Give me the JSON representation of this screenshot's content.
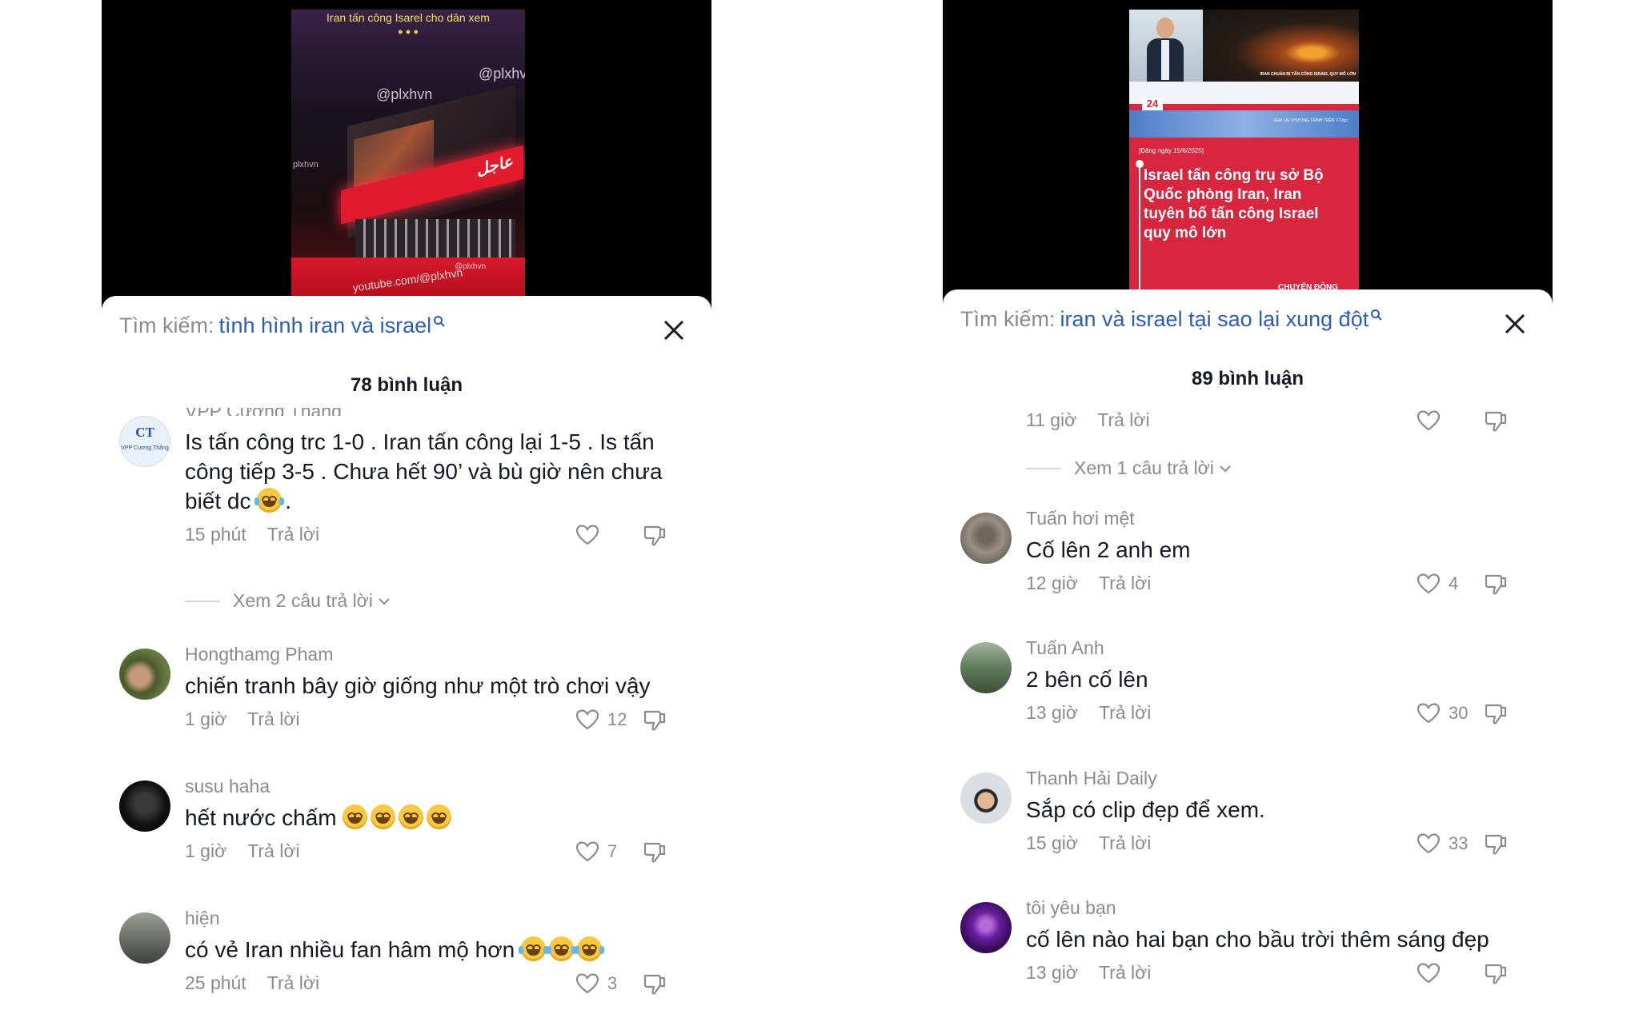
{
  "left": {
    "video": {
      "caption": "Iran tấn công Isarel cho dân xem",
      "watermarks": [
        "@plxhvn",
        "@plxhvn",
        "plxhvn",
        "youtube.com/@plxhvn",
        "@plxhvn"
      ],
      "sign_text": "عاجل"
    },
    "search": {
      "prefix": "Tìm kiếm:",
      "query": "tình hình iran và israel"
    },
    "comment_count": "78 bình luận",
    "comments": [
      {
        "user": "VPP Cương Thắng",
        "avatar_text": "CT",
        "avatar_sub": "VPP Cương Thắng",
        "avatar_color": "#e8f0f8",
        "text": "Is tấn công trc 1-0 . Iran tấn công lại 1-5 . Is tấn công tiếp 3-5 . Chưa hết 90’ và bù giờ nên chưa biết dc",
        "text_tail": ".",
        "time": "15 phút",
        "reply": "Trả lời",
        "likes": "",
        "view_replies": "Xem 2 câu trả lời"
      },
      {
        "user": "Hongthamg Pham",
        "avatar_color": "#5e6b42",
        "text": "chiến tranh bây giờ giống như một trò chơi vậy",
        "time": "1 giờ",
        "reply": "Trả lời",
        "likes": "12"
      },
      {
        "user": "susu haha",
        "avatar_color": "#151515",
        "text": "hết nước chấm",
        "time": "1 giờ",
        "reply": "Trả lời",
        "likes": "7"
      },
      {
        "user": "hiện",
        "avatar_color": "#6c6f69",
        "text": "có vẻ Iran nhiều fan hâm mộ hơn",
        "time": "25 phút",
        "reply": "Trả lời",
        "likes": "3"
      }
    ]
  },
  "right": {
    "video": {
      "channel_badge": "24",
      "headline_small": "IRAN CHUẨN BỊ TẤN CÔNG ISRAEL QUY MÔ LỚN",
      "ticker_small": "XEM LẠI CHƯƠNG TRÌNH TRÊN VTVgo",
      "date_tag": "[Đăng ngày 15/6/2025]",
      "headline": "Israel tấn công trụ sở Bộ Quốc phòng Iran, Iran tuyên bố tấn công Israel quy mô lớn",
      "footer_tag": "CHUYỂN ĐỘNG"
    },
    "search": {
      "prefix": "Tìm kiếm:",
      "query": "iran và israel tại sao lại xung đột"
    },
    "comment_count": "89 bình luận",
    "first_meta": {
      "time": "11 giờ",
      "reply": "Trả lời",
      "view_replies": "Xem 1 câu trả lời"
    },
    "comments": [
      {
        "user": "Tuấn hơi mệt",
        "avatar_color": "#8d8578",
        "text": "Cố lên 2 anh em",
        "time": "12 giờ",
        "reply": "Trả lời",
        "likes": "4"
      },
      {
        "user": "Tuấn Anh",
        "avatar_color": "#6d8a68",
        "text": "2 bên cố lên",
        "time": "13 giờ",
        "reply": "Trả lời",
        "likes": "30"
      },
      {
        "user": "Thanh Hải Daily",
        "avatar_color": "#d9dee3",
        "text": "Sắp có clip đẹp để xem.",
        "time": "15 giờ",
        "reply": "Trả lời",
        "likes": "33"
      },
      {
        "user": "tôi yêu bạn",
        "avatar_color": "#4b1670",
        "text": "cố lên nào hai bạn cho bầu trời thêm sáng đẹp",
        "time": "13 giờ",
        "reply": "Trả lời",
        "likes": ""
      }
    ]
  },
  "icons": {
    "search": "magnifier-icon",
    "close": "close-x-icon",
    "like": "heart-outline-icon",
    "dislike": "thumb-down-icon",
    "chevron": "chevron-down-icon"
  },
  "colors": {
    "accent_blue": "#2b5db9",
    "muted": "#8a8b91",
    "news_red": "#d7263d"
  }
}
